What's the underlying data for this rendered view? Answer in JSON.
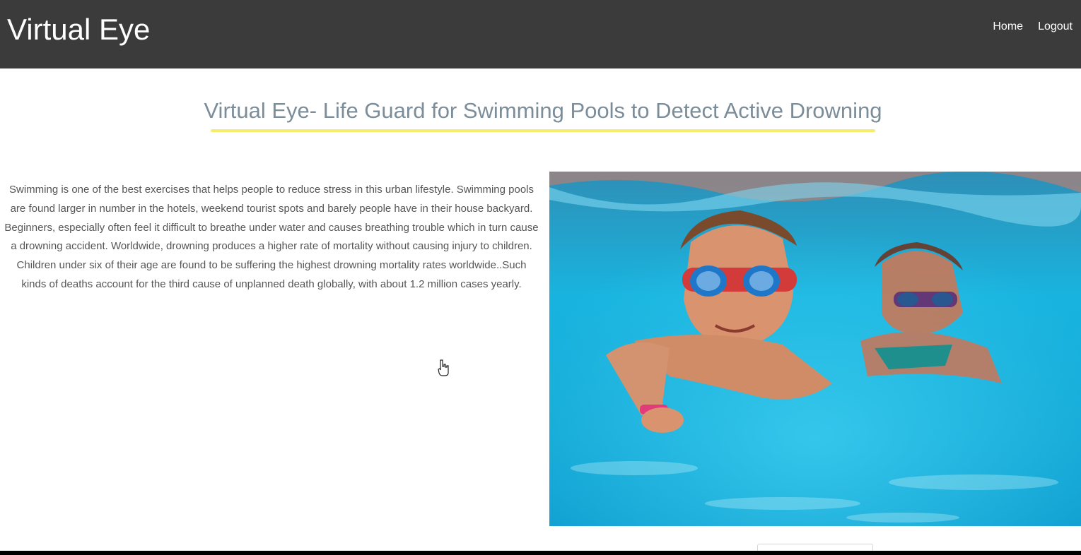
{
  "header": {
    "brand": "Virtual Eye",
    "nav": [
      {
        "label": "Home"
      },
      {
        "label": "Logout"
      }
    ]
  },
  "main": {
    "title": "Virtual Eye- Life Guard for Swimming Pools to Detect Active Drowning",
    "description": "Swimming is one of the best exercises that helps people to reduce stress in this urban lifestyle. Swimming pools are found larger in number in the hotels, weekend tourist spots and barely people have in their house backyard. Beginners, especially often feel it difficult to breathe under water and causes breathing trouble which in turn cause a drowning accident. Worldwide, drowning produces a higher rate of mortality without causing injury to children. Children under six of their age are found to be suffering the highest drowning mortality rates worldwide..Such kinds of deaths account for the third cause of unplanned death globally, with about 1.2 million cases yearly."
  },
  "colors": {
    "navbar": "#3b3b3b",
    "title": "#7c8d9a",
    "underline": "#f4ee6c",
    "water": "#1aa8d0"
  }
}
